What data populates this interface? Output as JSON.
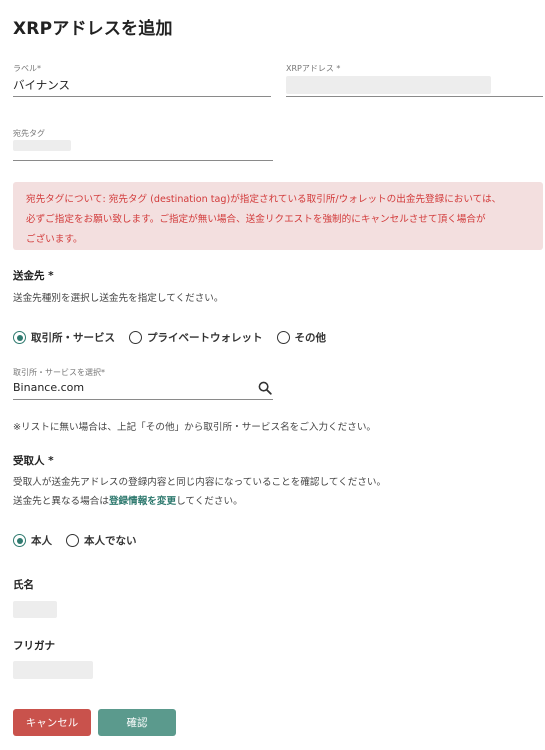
{
  "page": {
    "title": "XRPアドレスを追加"
  },
  "label_field": {
    "label": "ラベル*",
    "value": "バイナンス"
  },
  "address_field": {
    "label": "XRPアドレス *"
  },
  "tag_field": {
    "label": "宛先タグ"
  },
  "alert": {
    "line1": "宛先タグについて: 宛先タグ (destination tag)が指定されている取引所/ウォレットの出金先登録においては、",
    "line2": "必ずご指定をお願い致します。ご指定が無い場合、送金リクエストを強制的にキャンセルさせて頂く場合が",
    "line3": "ございます。"
  },
  "destination": {
    "title": "送金先 *",
    "desc": "送金先種別を選択し送金先を指定してください。",
    "options": [
      "取引所・サービス",
      "プライベートウォレット",
      "その他"
    ],
    "selected_index": 0,
    "exchange_label": "取引所・サービスを選択*",
    "exchange_value": "Binance.com",
    "note": "※リストに無い場合は、上記「その他」から取引所・サービス名をご入力ください。"
  },
  "recipient": {
    "title": "受取人 *",
    "desc1": "受取人が送金先アドレスの登録内容と同じ内容になっていることを確認してください。",
    "desc2_prefix": "送金先と異なる場合は",
    "desc2_link": "登録情報を変更",
    "desc2_suffix": "してください。",
    "options": [
      "本人",
      "本人でない"
    ],
    "selected_index": 0
  },
  "name": {
    "title": "氏名"
  },
  "furigana": {
    "title": "フリガナ"
  },
  "buttons": {
    "cancel": "キャンセル",
    "confirm": "確認"
  },
  "colors": {
    "accent": "#2f7a6f",
    "danger": "#c9524c",
    "confirm": "#5b9a8d",
    "alert_bg": "#f3dfdf",
    "alert_text": "#d23a3a"
  },
  "icons": {
    "search": "search-icon"
  }
}
